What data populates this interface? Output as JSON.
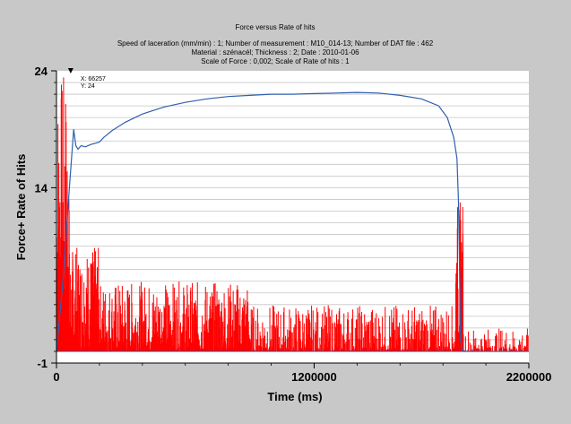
{
  "window": {
    "background": "#c8c8c8"
  },
  "chart_data": {
    "type": "bar",
    "title": "Force versus Rate of hits",
    "subtitle_lines": [
      "Speed of laceration (mm/min) : 1;    Number of measurement : M10_014-13;    Number of DAT file : 462",
      "Material : szénacél;    Thickness : 2;    Date : 2010-01-06",
      "Scale of Force : 0,002;    Scale of Rate of hits : 1"
    ],
    "xlabel": "Time (ms)",
    "ylabel": "Force+ Rate of Hits",
    "xlim": [
      0,
      2200000
    ],
    "ylim": [
      -1,
      24
    ],
    "x_ticks": [
      0,
      1200000,
      2200000
    ],
    "x_tick_labels": [
      "0",
      "1200000",
      "2200000"
    ],
    "y_ticks": [
      -1,
      14,
      24
    ],
    "y_tick_labels": [
      "-1",
      "14",
      "24"
    ],
    "grid": true,
    "legend": "none",
    "cursor_readout": {
      "x_text": "X: 66257",
      "y_text": "Y: 24",
      "x": 66257,
      "y": 24
    },
    "series": [
      {
        "type": "line",
        "color": "#2f5fb0",
        "points": [
          [
            0,
            0
          ],
          [
            30000,
            6
          ],
          [
            60000,
            14
          ],
          [
            80000,
            19
          ],
          [
            90000,
            17.6
          ],
          [
            100000,
            17.3
          ],
          [
            115000,
            17.6
          ],
          [
            135000,
            17.5
          ],
          [
            160000,
            17.7
          ],
          [
            200000,
            17.9
          ],
          [
            220000,
            18.3
          ],
          [
            260000,
            18.9
          ],
          [
            320000,
            19.6
          ],
          [
            400000,
            20.3
          ],
          [
            500000,
            20.9
          ],
          [
            600000,
            21.3
          ],
          [
            700000,
            21.6
          ],
          [
            800000,
            21.8
          ],
          [
            900000,
            21.9
          ],
          [
            1000000,
            22.0
          ],
          [
            1100000,
            22.0
          ],
          [
            1200000,
            22.05
          ],
          [
            1300000,
            22.1
          ],
          [
            1400000,
            22.15
          ],
          [
            1500000,
            22.1
          ],
          [
            1600000,
            21.9
          ],
          [
            1700000,
            21.6
          ],
          [
            1780000,
            21.0
          ],
          [
            1820000,
            20.0
          ],
          [
            1850000,
            18.3
          ],
          [
            1865000,
            16.5
          ],
          [
            1872000,
            13.0
          ],
          [
            1878000,
            6.0
          ],
          [
            1882000,
            1.0
          ],
          [
            1890000,
            0
          ],
          [
            2200000,
            0
          ]
        ]
      },
      {
        "type": "bar",
        "color": "#ff0000",
        "segments": [
          {
            "x_range": [
              0,
              60000
            ],
            "bars": 60,
            "value_range": [
              2,
              24
            ]
          },
          {
            "x_range": [
              60000,
              200000
            ],
            "bars": 140,
            "value_range": [
              0,
              9
            ]
          },
          {
            "x_range": [
              200000,
              900000
            ],
            "bars": 500,
            "value_range": [
              0,
              6
            ]
          },
          {
            "x_range": [
              900000,
              1860000
            ],
            "bars": 420,
            "value_range": [
              0,
              4
            ]
          },
          {
            "x_range": [
              1860000,
              1895000
            ],
            "bars": 35,
            "value_range": [
              1,
              13
            ]
          },
          {
            "x_range": [
              1895000,
              2200000
            ],
            "bars": 90,
            "value_range": [
              0,
              2
            ]
          }
        ]
      }
    ]
  }
}
